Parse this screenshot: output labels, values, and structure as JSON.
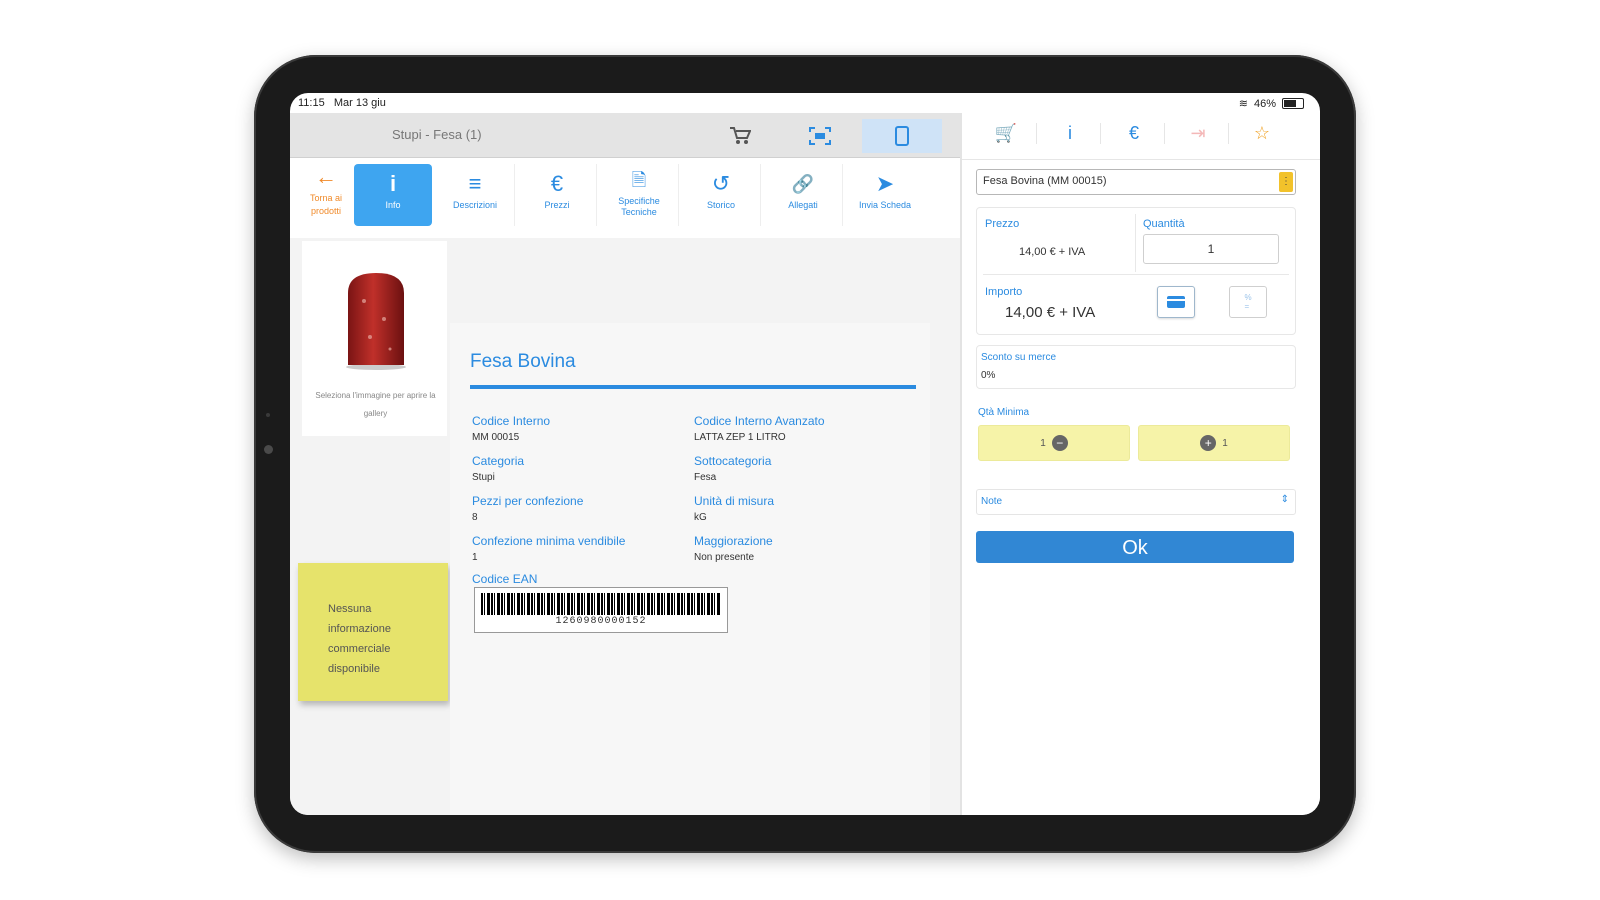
{
  "status": {
    "time": "11:15",
    "date": "Mar 13 giu",
    "battery": "46%"
  },
  "topbar": {
    "title": "Stupi - Fesa (1)",
    "buttons": [
      {
        "icon": "cart-icon",
        "glyph": "🛒"
      },
      {
        "icon": "scan-icon",
        "glyph": "⛶"
      },
      {
        "icon": "tablet-icon",
        "glyph": "▯"
      }
    ]
  },
  "nav": {
    "back": {
      "icon": "←",
      "label": "Torna ai prodotti"
    },
    "items": [
      {
        "icon": "i",
        "label": "Info"
      },
      {
        "icon": "≡",
        "label": "Descrizioni"
      },
      {
        "icon": "€",
        "label": "Prezzi"
      },
      {
        "icon": "🗎",
        "label": "Specifiche Tecniche"
      },
      {
        "icon": "↺",
        "label": "Storico"
      },
      {
        "icon": "🔗",
        "label": "Allegati"
      },
      {
        "icon": "➤",
        "label": "Invia Scheda"
      }
    ]
  },
  "image_caption": "Seleziona l'immagine per aprire la gallery",
  "sticky_note": "Nessuna informazione commerciale disponibile",
  "product": {
    "title": "Fesa Bovina",
    "fields": {
      "codice_interno": {
        "label": "Codice Interno",
        "value": "MM 00015"
      },
      "codice_interno_avanzato": {
        "label": "Codice Interno Avanzato",
        "value": "LATTA ZEP 1 LITRO"
      },
      "categoria": {
        "label": "Categoria",
        "value": "Stupi"
      },
      "sottocategoria": {
        "label": "Sottocategoria",
        "value": "Fesa"
      },
      "pezzi": {
        "label": "Pezzi per confezione",
        "value": "8"
      },
      "unita": {
        "label": "Unità di misura",
        "value": "kG"
      },
      "confezione_minima": {
        "label": "Confezione minima vendibile",
        "value": "1"
      },
      "maggiorazione": {
        "label": "Maggiorazione",
        "value": "Non presente"
      },
      "ean": {
        "label": "Codice EAN",
        "value": "1260980000152"
      }
    }
  },
  "right": {
    "tabs": [
      "🛒",
      "i",
      "€",
      "⇥",
      "☆"
    ],
    "product_select": "Fesa Bovina (MM 00015)",
    "price_label": "Prezzo",
    "price_value": "14,00 € + IVA",
    "quantity_label": "Quantità",
    "quantity_value": "1",
    "amount_label": "Importo",
    "amount_value": "14,00 € + IVA",
    "discount_label": "Sconto su merce",
    "discount_value": "0%",
    "qty_min_label": "Qtà Minima",
    "minus_label": "1",
    "plus_label": "1",
    "notes_label": "Note",
    "ok_label": "Ok"
  },
  "colors": {
    "accent": "#2b8be0",
    "active_tab": "#3ea5f0",
    "sticky": "#e6e36b",
    "ok": "#3187d4",
    "back": "#f08a2a"
  }
}
